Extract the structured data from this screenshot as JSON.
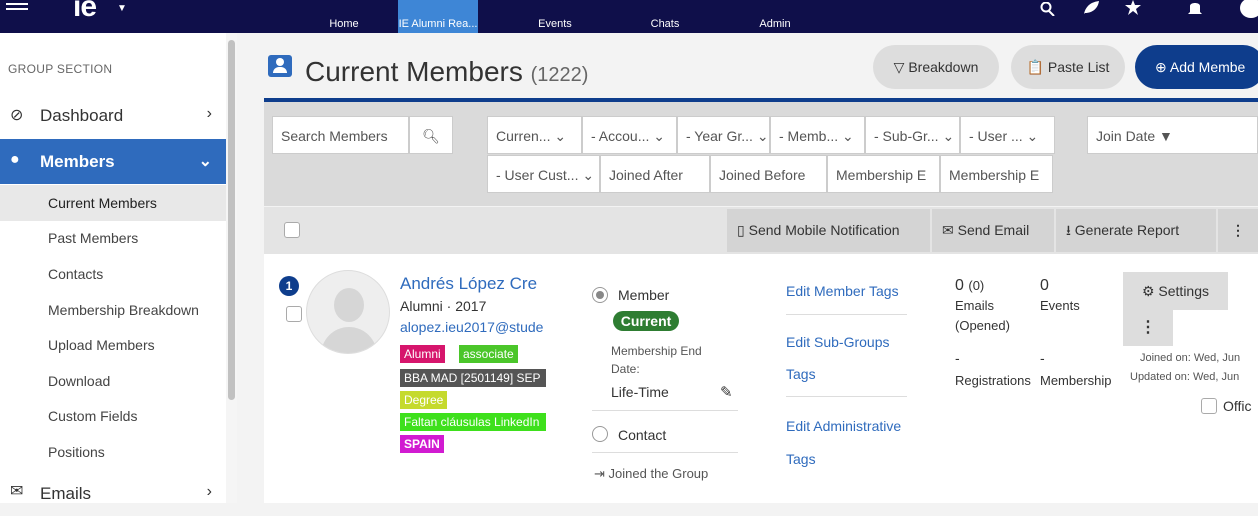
{
  "topbar": {
    "logo": "ie",
    "nav": [
      {
        "label": "Home",
        "icon": "home-icon"
      },
      {
        "label": "IE Alumni Rea...",
        "icon": "group-icon"
      },
      {
        "label": "Events",
        "icon": "calendar-icon"
      },
      {
        "label": "Chats",
        "icon": "chat-icon"
      },
      {
        "label": "Admin",
        "icon": "admin-icon"
      }
    ],
    "right_icons": [
      "search-icon",
      "leaf-icon",
      "star-icon",
      "bell-icon",
      "avatar-icon"
    ]
  },
  "sidebar": {
    "section_label": "GROUP SECTION",
    "items": [
      {
        "label": "Dashboard",
        "icon": "dashboard-icon"
      },
      {
        "label": "Members",
        "icon": "user-icon"
      },
      {
        "label": "Emails",
        "icon": "mail-icon"
      }
    ],
    "sub_items": [
      "Current Members",
      "Past Members",
      "Contacts",
      "Membership Breakdown",
      "Upload Members",
      "Download",
      "Custom Fields",
      "Positions"
    ]
  },
  "header": {
    "title": "Current Members",
    "count": "(1222)",
    "breakdown_label": "Breakdown",
    "paste_label": "Paste List",
    "add_label": "Add Membe"
  },
  "filters": {
    "search_placeholder": "Search Members",
    "row1": [
      "Curren...",
      "- Accou...",
      "- Year Gr...",
      "- Memb...",
      "- Sub-Gr...",
      "- User ..."
    ],
    "join_date": "Join Date ▼",
    "row2": [
      "- User Cust...",
      "Joined After",
      "Joined Before",
      "Membership E",
      "Membership E"
    ]
  },
  "actions": {
    "notify": "Send Mobile Notification",
    "email": "Send Email",
    "report": "Generate Report"
  },
  "member": {
    "index": "1",
    "name": "Andrés López Cre",
    "subtitle": "Alumni · 2017",
    "email": "alopez.ieu2017@stude",
    "tags": [
      {
        "label": "Alumni",
        "color": "#d6156c"
      },
      {
        "label": "associate",
        "color": "#4bc62a"
      },
      {
        "label": "BBA MAD [2501149] SEP",
        "color": "#555555"
      },
      {
        "label": "Degree",
        "color": "#c5da2d"
      },
      {
        "label": "Faltan cláusulas LinkedIn",
        "color": "#3ee01c"
      },
      {
        "label": "SPAIN",
        "color": "#d11bd1"
      }
    ],
    "role_member": "Member",
    "status": "Current",
    "membership_end_label": "Membership End Date:",
    "membership_end_line1": "Membership End",
    "membership_end_line2": "Date:",
    "membership_end_value": "Life-Time",
    "role_contact": "Contact",
    "joined_group": "Joined the Group",
    "links": [
      "Edit Member Tags",
      "Edit Sub-Groups",
      "Tags",
      "Edit Administrative",
      "Tags"
    ],
    "stats": {
      "emails_count": "0",
      "emails_opened": "(0)",
      "emails_label": "Emails",
      "opened_label": "(Opened)",
      "events_count": "0",
      "events_label": "Events",
      "reg_dash": "-",
      "mem_dash": "-",
      "registrations_label": "Registrations",
      "membership_label": "Membership"
    },
    "settings_label": "Settings",
    "joined_on": "Joined on: Wed, Jun",
    "updated_on": "Updated on: Wed, Jun",
    "officer_label": "Offic"
  }
}
